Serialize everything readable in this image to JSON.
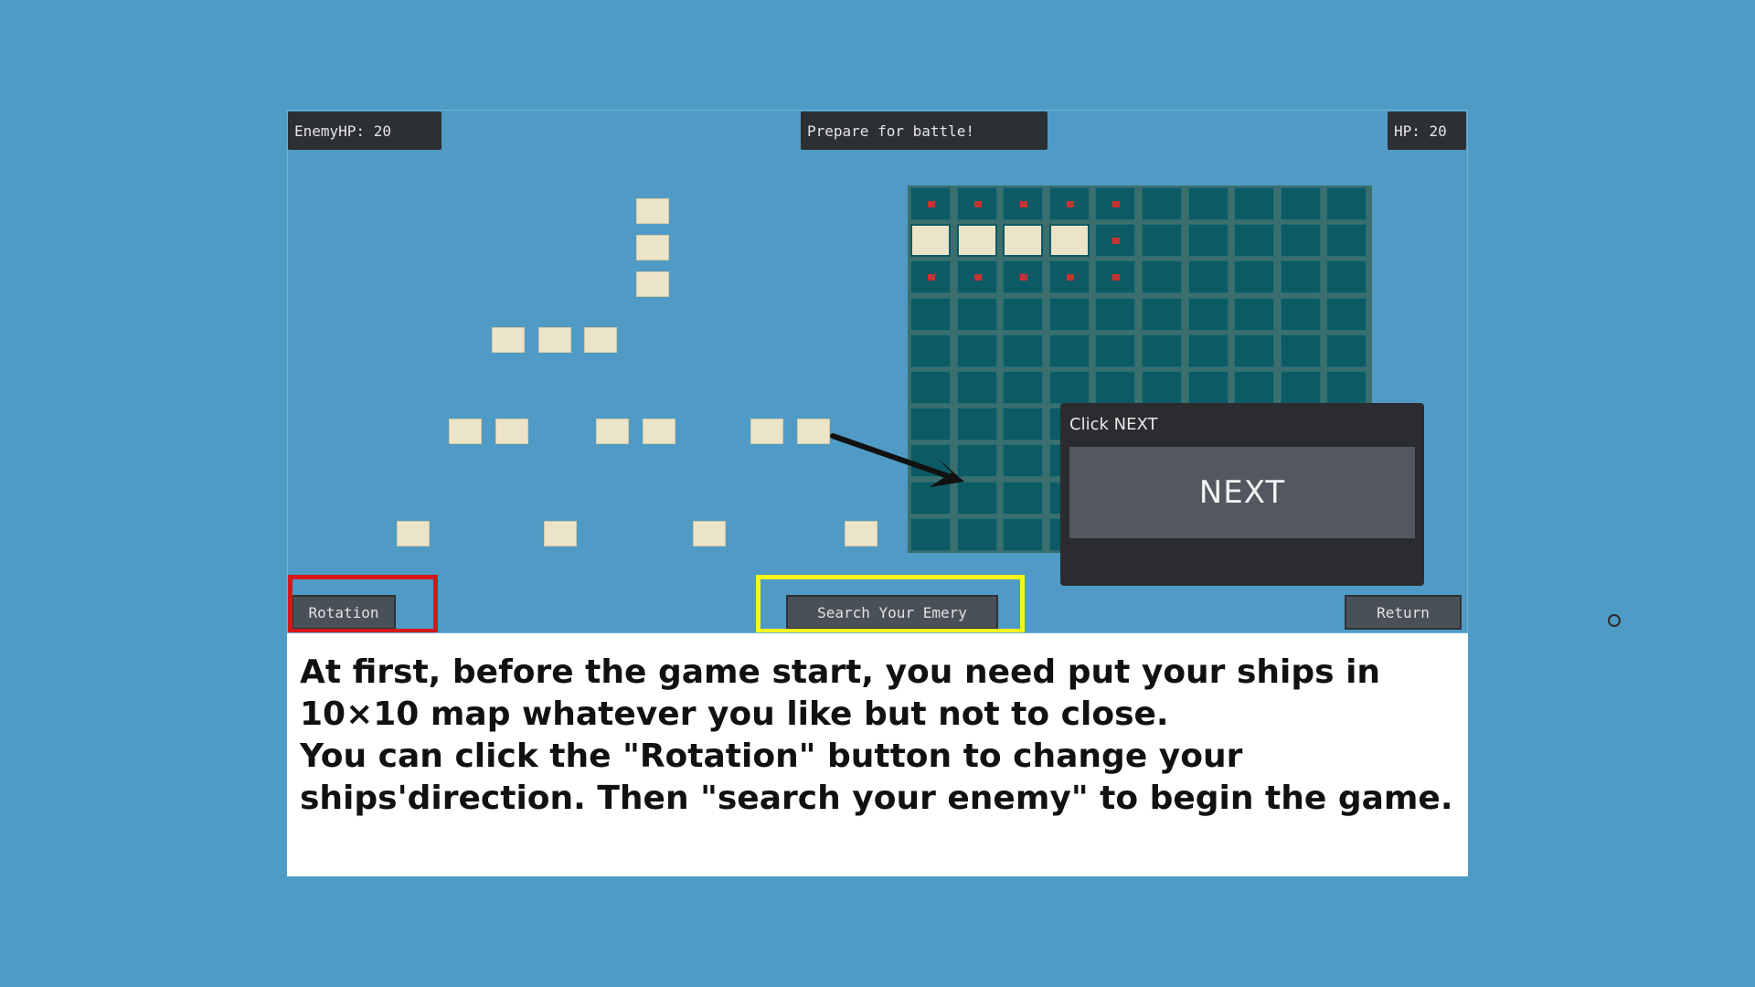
{
  "hud": {
    "enemy_hp": "EnemyHP: 20",
    "status": "Prepare for battle!",
    "player_hp": "HP: 20"
  },
  "board": {
    "rows": 10,
    "cols": 10,
    "placed_ship_cells": [
      [
        1,
        0
      ],
      [
        1,
        1
      ],
      [
        1,
        2
      ],
      [
        1,
        3
      ]
    ],
    "blocked_marker_cells": [
      [
        0,
        0
      ],
      [
        0,
        1
      ],
      [
        0,
        2
      ],
      [
        0,
        3
      ],
      [
        0,
        4
      ],
      [
        1,
        4
      ],
      [
        2,
        0
      ],
      [
        2,
        1
      ],
      [
        2,
        2
      ],
      [
        2,
        3
      ],
      [
        2,
        4
      ]
    ]
  },
  "next_panel": {
    "title": "Click NEXT",
    "button_label": "NEXT"
  },
  "buttons": {
    "rotation": "Rotation",
    "search": "Search Your Emery",
    "return": "Return"
  },
  "instructions": {
    "line1": "At first, before the game start, you need put your ships in 10×10 map whatever you like but not to close.",
    "line2": "You can click the \"Rotation\" button to change your ships'direction. Then \"search your enemy\" to begin the game."
  },
  "colors": {
    "background": "#4e9cc6",
    "grid_cell": "#0c5a64",
    "ship": "#ece4c8",
    "marker": "#c83232",
    "rotation_highlight": "#d41818",
    "search_highlight": "#f5f51a"
  }
}
